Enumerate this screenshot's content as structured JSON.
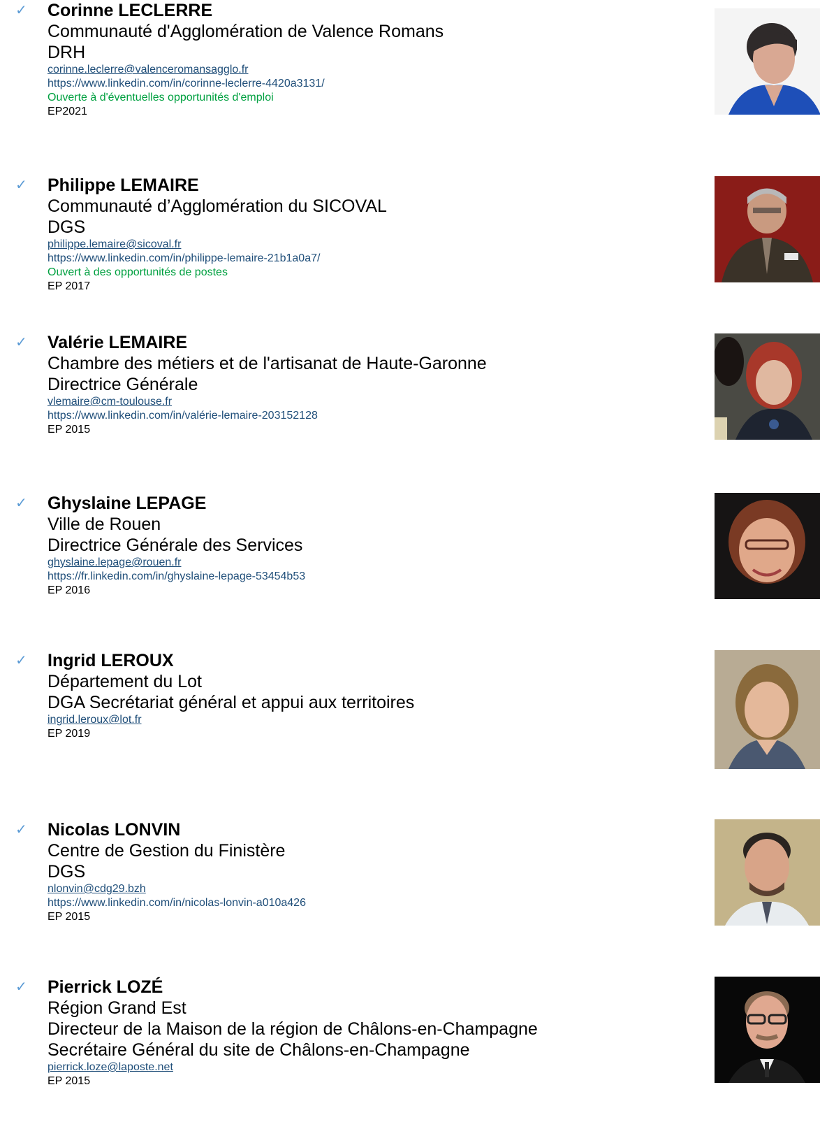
{
  "entries": [
    {
      "check": "✓",
      "name": "Corinne LECLERRE",
      "organization": "Communauté d'Agglomération de Valence Romans",
      "roles": [
        "DRH"
      ],
      "email": "corinne.leclerre@valenceromansagglo.fr",
      "linkedin": "https://www.linkedin.com/in/corinne-leclerre-4420a3131/",
      "note": "Ouverte à d'éventuelles opportunités d'emploi",
      "ep": "EP2021"
    },
    {
      "check": "✓",
      "name": "Philippe LEMAIRE",
      "organization": "Communauté d’Agglomération du SICOVAL",
      "roles": [
        "DGS"
      ],
      "email": "philippe.lemaire@sicoval.fr",
      "linkedin": "https://www.linkedin.com/in/philippe-lemaire-21b1a0a7/",
      "note": "Ouvert à des opportunités de postes",
      "ep": "EP 2017"
    },
    {
      "check": "✓",
      "name": "Valérie LEMAIRE",
      "organization": "Chambre des métiers et de l'artisanat de Haute-Garonne",
      "roles": [
        "Directrice Générale"
      ],
      "email": "vlemaire@cm-toulouse.fr",
      "linkedin": "https://www.linkedin.com/in/valérie-lemaire-203152128",
      "note": "",
      "ep": "EP 2015"
    },
    {
      "check": "✓",
      "name": "Ghyslaine LEPAGE",
      "organization": "Ville de Rouen",
      "roles": [
        "Directrice Générale des Services"
      ],
      "email": "ghyslaine.lepage@rouen.fr",
      "linkedin": "https://fr.linkedin.com/in/ghyslaine-lepage-53454b53",
      "note": "",
      "ep": "EP 2016"
    },
    {
      "check": "✓",
      "name": "Ingrid LEROUX",
      "organization": "Département du Lot",
      "roles": [
        "DGA Secrétariat général et appui aux territoires"
      ],
      "email": "ingrid.leroux@lot.fr",
      "linkedin": "",
      "note": "",
      "ep": "EP 2019"
    },
    {
      "check": "✓",
      "name": "Nicolas LONVIN",
      "organization": "Centre de Gestion du Finistère",
      "roles": [
        "DGS"
      ],
      "email": "nlonvin@cdg29.bzh",
      "linkedin": "https://www.linkedin.com/in/nicolas-lonvin-a010a426",
      "note": "",
      "ep": "EP 2015"
    },
    {
      "check": "✓",
      "name": "Pierrick LOZÉ",
      "organization": "Région Grand Est",
      "roles": [
        "Directeur de la Maison de la région de Châlons-en-Champagne",
        "Secrétaire Général du site de Châlons-en-Champagne"
      ],
      "email": "pierrick.loze@laposte.net",
      "linkedin": "",
      "note": "",
      "ep": "EP 2015"
    }
  ],
  "colors": {
    "check": "#5b9bd5",
    "link": "#1f4e79",
    "note": "#00a040"
  },
  "icons": [
    "check-mark-icon",
    "portrait-photo"
  ]
}
